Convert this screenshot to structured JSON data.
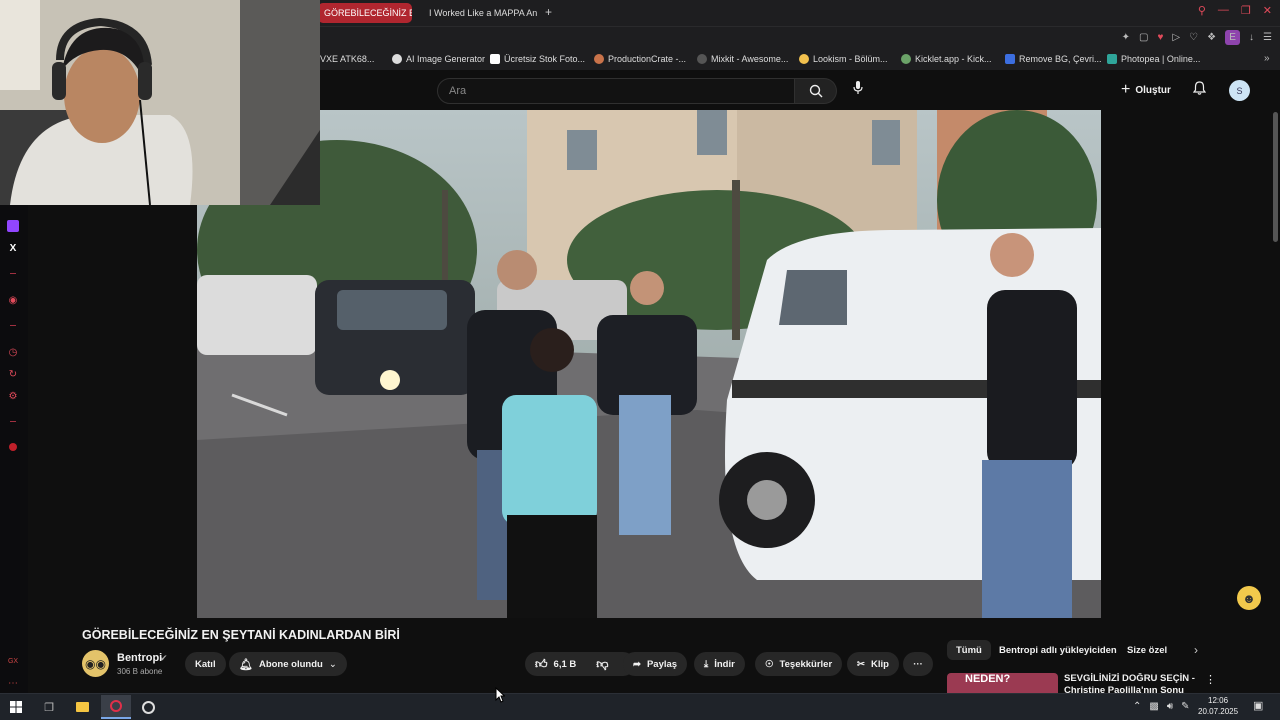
{
  "browser": {
    "tabs": [
      {
        "label": "GÖREBİLECEĞİNİZ EN",
        "active": true
      },
      {
        "label": "I Worked Like a MAPPA An",
        "active": false
      }
    ],
    "new_tab": "+",
    "bookmarks": [
      "VXE ATK68...",
      "AI Image Generator",
      "Ücretsiz Stok Foto...",
      "ProductionCrate -...",
      "Mixkit - Awesome...",
      "Lookism - Bölüm...",
      "Kicklet.app - Kick...",
      "Remove BG, Çevri...",
      "Photopea | Online..."
    ],
    "extension_letter": "E"
  },
  "header": {
    "search_placeholder": "Ara",
    "create_label": "Oluştur",
    "avatar_letter": "S"
  },
  "video": {
    "title": "GÖREBİLECEĞİNİZ EN ŞEYTANİ KADINLARDAN BİRİ",
    "channel": {
      "name": "Bentropi",
      "subscribers": "306 B abone"
    },
    "join_label": "Katıl",
    "subscribed_label": "Abone olundu",
    "likes": "6,1 B",
    "share_label": "Paylaş",
    "download_label": "İndir",
    "thanks_label": "Teşekkürler",
    "clip_label": "Klip",
    "more_label": "···"
  },
  "chips": [
    {
      "label": "Tümü",
      "selected": true
    },
    {
      "label": "Bentropi adlı yükleyiciden",
      "selected": false
    },
    {
      "label": "Size özel",
      "selected": false
    }
  ],
  "recommendation": {
    "title": "SEVGİLİNİZİ DOĞRU SEÇİN - Christine Paolilla'nın Sonu",
    "thumb_text": "NEDEN?"
  },
  "taskbar": {
    "time": "12:06",
    "date": "20.07.2025"
  },
  "colors": {
    "accent_red": "#b0262f",
    "background": "#0f0f0f"
  }
}
